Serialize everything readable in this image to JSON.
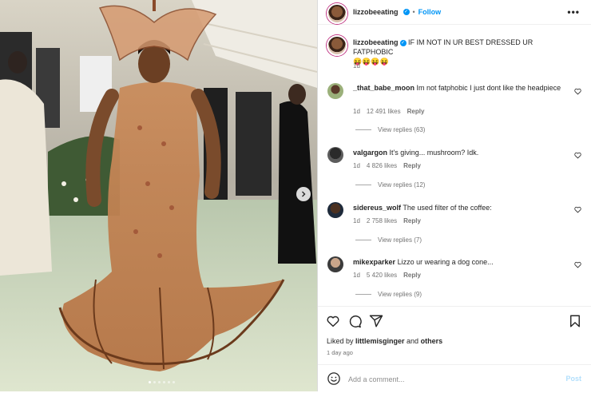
{
  "header": {
    "username": "lizzobeeating",
    "follow_label": "Follow",
    "separator": "•",
    "more_label": "•••"
  },
  "caption": {
    "username": "lizzobeeating",
    "text": "IF IM NOT IN UR BEST DRESSED UR FATPHOBIC",
    "emojis": "😝😝😝😝",
    "time": "1d"
  },
  "comments": [
    {
      "username": "_that_babe_moon",
      "text": "Im not fatphobic I just dont like the headpiece",
      "time": "1d",
      "likes": "12 491 likes",
      "reply_label": "Reply",
      "view_replies": "View replies (63)"
    },
    {
      "username": "valgargon",
      "text": "It's giving... mushroom? Idk.",
      "time": "1d",
      "likes": "4 826 likes",
      "reply_label": "Reply",
      "view_replies": "View replies (12)"
    },
    {
      "username": "sidereus_wolf",
      "text": "The used filter of the coffee:",
      "time": "1d",
      "likes": "2 758 likes",
      "reply_label": "Reply",
      "view_replies": "View replies (7)"
    },
    {
      "username": "mikexparker",
      "text": "Lizzo ur wearing a dog cone...",
      "time": "1d",
      "likes": "5 420 likes",
      "reply_label": "Reply",
      "view_replies": "View replies (9)"
    }
  ],
  "likes_line": {
    "prefix": "Liked by ",
    "user": "littlemisginger",
    "middle": " and ",
    "others": "others"
  },
  "post_age": "1 day ago",
  "comment_box": {
    "placeholder": "Add a comment...",
    "post_label": "Post"
  },
  "carousel": {
    "total": 6,
    "active": 1
  },
  "colors": {
    "accent": "#0095f6",
    "post_disabled": "#b2dffc"
  },
  "icons": [
    "heart-icon",
    "comment-icon",
    "share-icon",
    "bookmark-icon",
    "emoji-icon",
    "chevron-right-icon",
    "verified-icon"
  ]
}
